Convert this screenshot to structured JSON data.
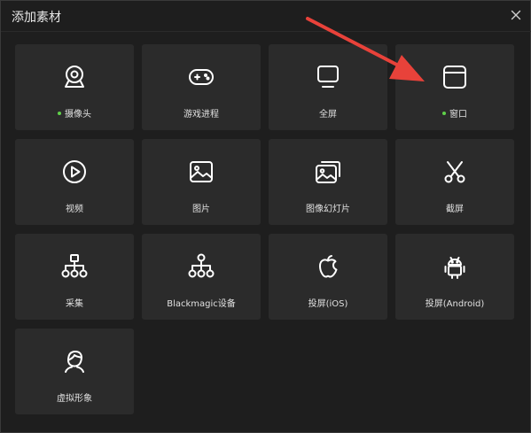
{
  "dialog": {
    "title": "添加素材",
    "close_icon": "close-icon"
  },
  "tiles": [
    {
      "label": "摄像头",
      "icon": "webcam-icon",
      "active": true
    },
    {
      "label": "游戏进程",
      "icon": "gamepad-icon",
      "active": false
    },
    {
      "label": "全屏",
      "icon": "monitor-icon",
      "active": false
    },
    {
      "label": "窗口",
      "icon": "window-icon",
      "active": true
    },
    {
      "label": "视频",
      "icon": "play-circle-icon",
      "active": false
    },
    {
      "label": "图片",
      "icon": "image-icon",
      "active": false
    },
    {
      "label": "图像幻灯片",
      "icon": "image-stack-icon",
      "active": false
    },
    {
      "label": "截屏",
      "icon": "scissors-icon",
      "active": false
    },
    {
      "label": "采集",
      "icon": "capture-tree-icon",
      "active": false
    },
    {
      "label": "Blackmagic设备",
      "icon": "blackmagic-tree-icon",
      "active": false
    },
    {
      "label": "投屏(iOS)",
      "icon": "apple-icon",
      "active": false
    },
    {
      "label": "投屏(Android)",
      "icon": "android-icon",
      "active": false
    },
    {
      "label": "虚拟形象",
      "icon": "avatar-icon",
      "active": false
    }
  ],
  "colors": {
    "background": "#1e1e1e",
    "tile": "#2b2b2b",
    "active_dot": "#5fd14a",
    "annotation_arrow": "#e8423a"
  }
}
